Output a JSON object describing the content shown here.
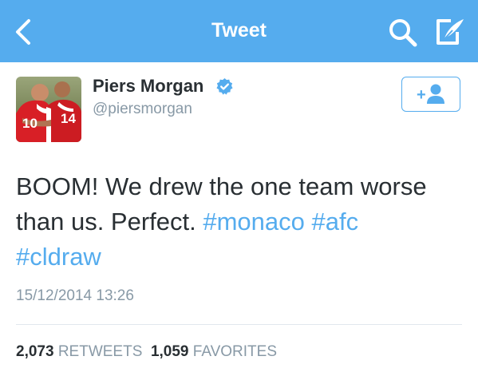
{
  "navbar": {
    "title": "Tweet",
    "background_color": "#55acee",
    "back_icon": "chevron-left-icon",
    "search_icon": "search-icon",
    "compose_icon": "compose-tweet-icon"
  },
  "tweet": {
    "author": {
      "display_name": "Piers Morgan",
      "handle": "@piersmorgan",
      "verified": true,
      "avatar_jersey_numbers": [
        "10",
        "14"
      ]
    },
    "follow_button_label": "+",
    "text_parts": [
      {
        "text": "BOOM! We drew the one team worse than us. Perfect. ",
        "type": "text"
      },
      {
        "text": "#monaco",
        "type": "hashtag"
      },
      {
        "text": " ",
        "type": "text"
      },
      {
        "text": "#afc",
        "type": "hashtag"
      },
      {
        "text": " ",
        "type": "text"
      },
      {
        "text": "#cldraw",
        "type": "hashtag"
      }
    ],
    "timestamp": "15/12/2014 13:26",
    "retweets_count": "2,073",
    "retweets_label": "RETWEETS",
    "favorites_count": "1,059",
    "favorites_label": "FAVORITES"
  },
  "colors": {
    "accent": "#55acee",
    "text_primary": "#292f33",
    "text_secondary": "#8899a6"
  }
}
